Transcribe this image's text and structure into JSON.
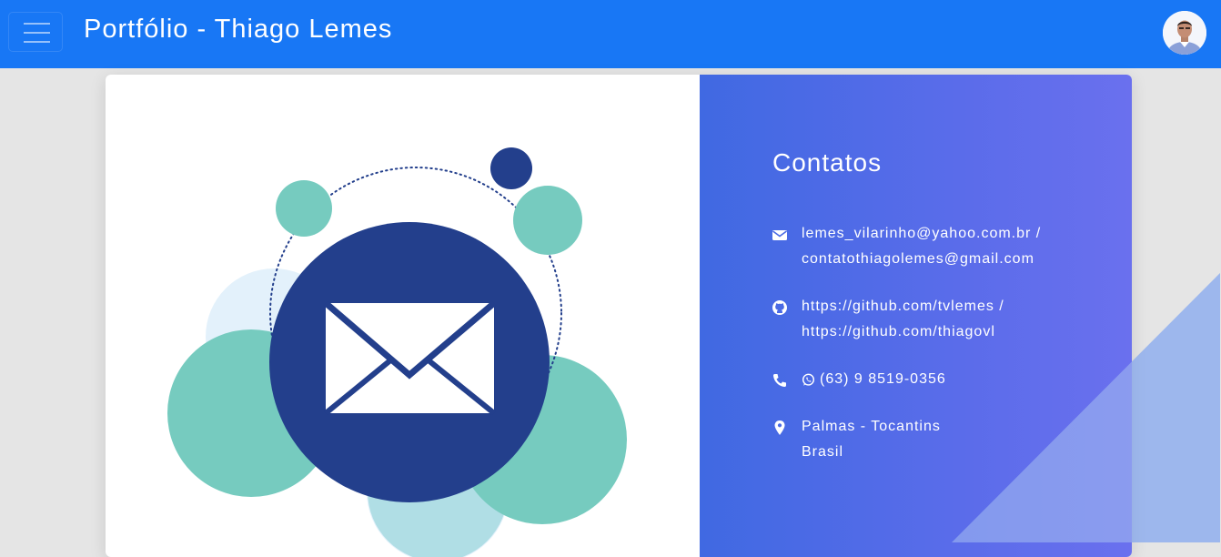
{
  "navbar": {
    "brand": "Portfólio - Thiago Lemes",
    "menu_icon": "hamburger-menu-icon",
    "avatar": "profile-photo",
    "background_color": "#1877f5"
  },
  "contact": {
    "title": "Contatos",
    "panel_colors": [
      "#4069e2",
      "#6a70ee"
    ],
    "items": [
      {
        "icon": "envelope-icon",
        "lines": [
          "lemes_vilarinho@yahoo.com.br /",
          "contatothiagolemes@gmail.com"
        ]
      },
      {
        "icon": "github-icon",
        "lines": [
          "https://github.com/tvlemes /",
          "https://github.com/thiagovl"
        ]
      },
      {
        "icon": "phone-icon",
        "inline_icon": "whatsapp-icon",
        "lines": [
          "(63) 9 8519-0356"
        ]
      },
      {
        "icon": "map-marker-icon",
        "lines": [
          "Palmas - Tocantins",
          "Brasil"
        ]
      }
    ]
  },
  "illustration": {
    "subject": "envelope-illustration",
    "colors": {
      "navy": "#233f8c",
      "teal": "#76cbbf",
      "light_blue": "#e3f1fb",
      "pale_teal": "#a7dbe0"
    }
  }
}
